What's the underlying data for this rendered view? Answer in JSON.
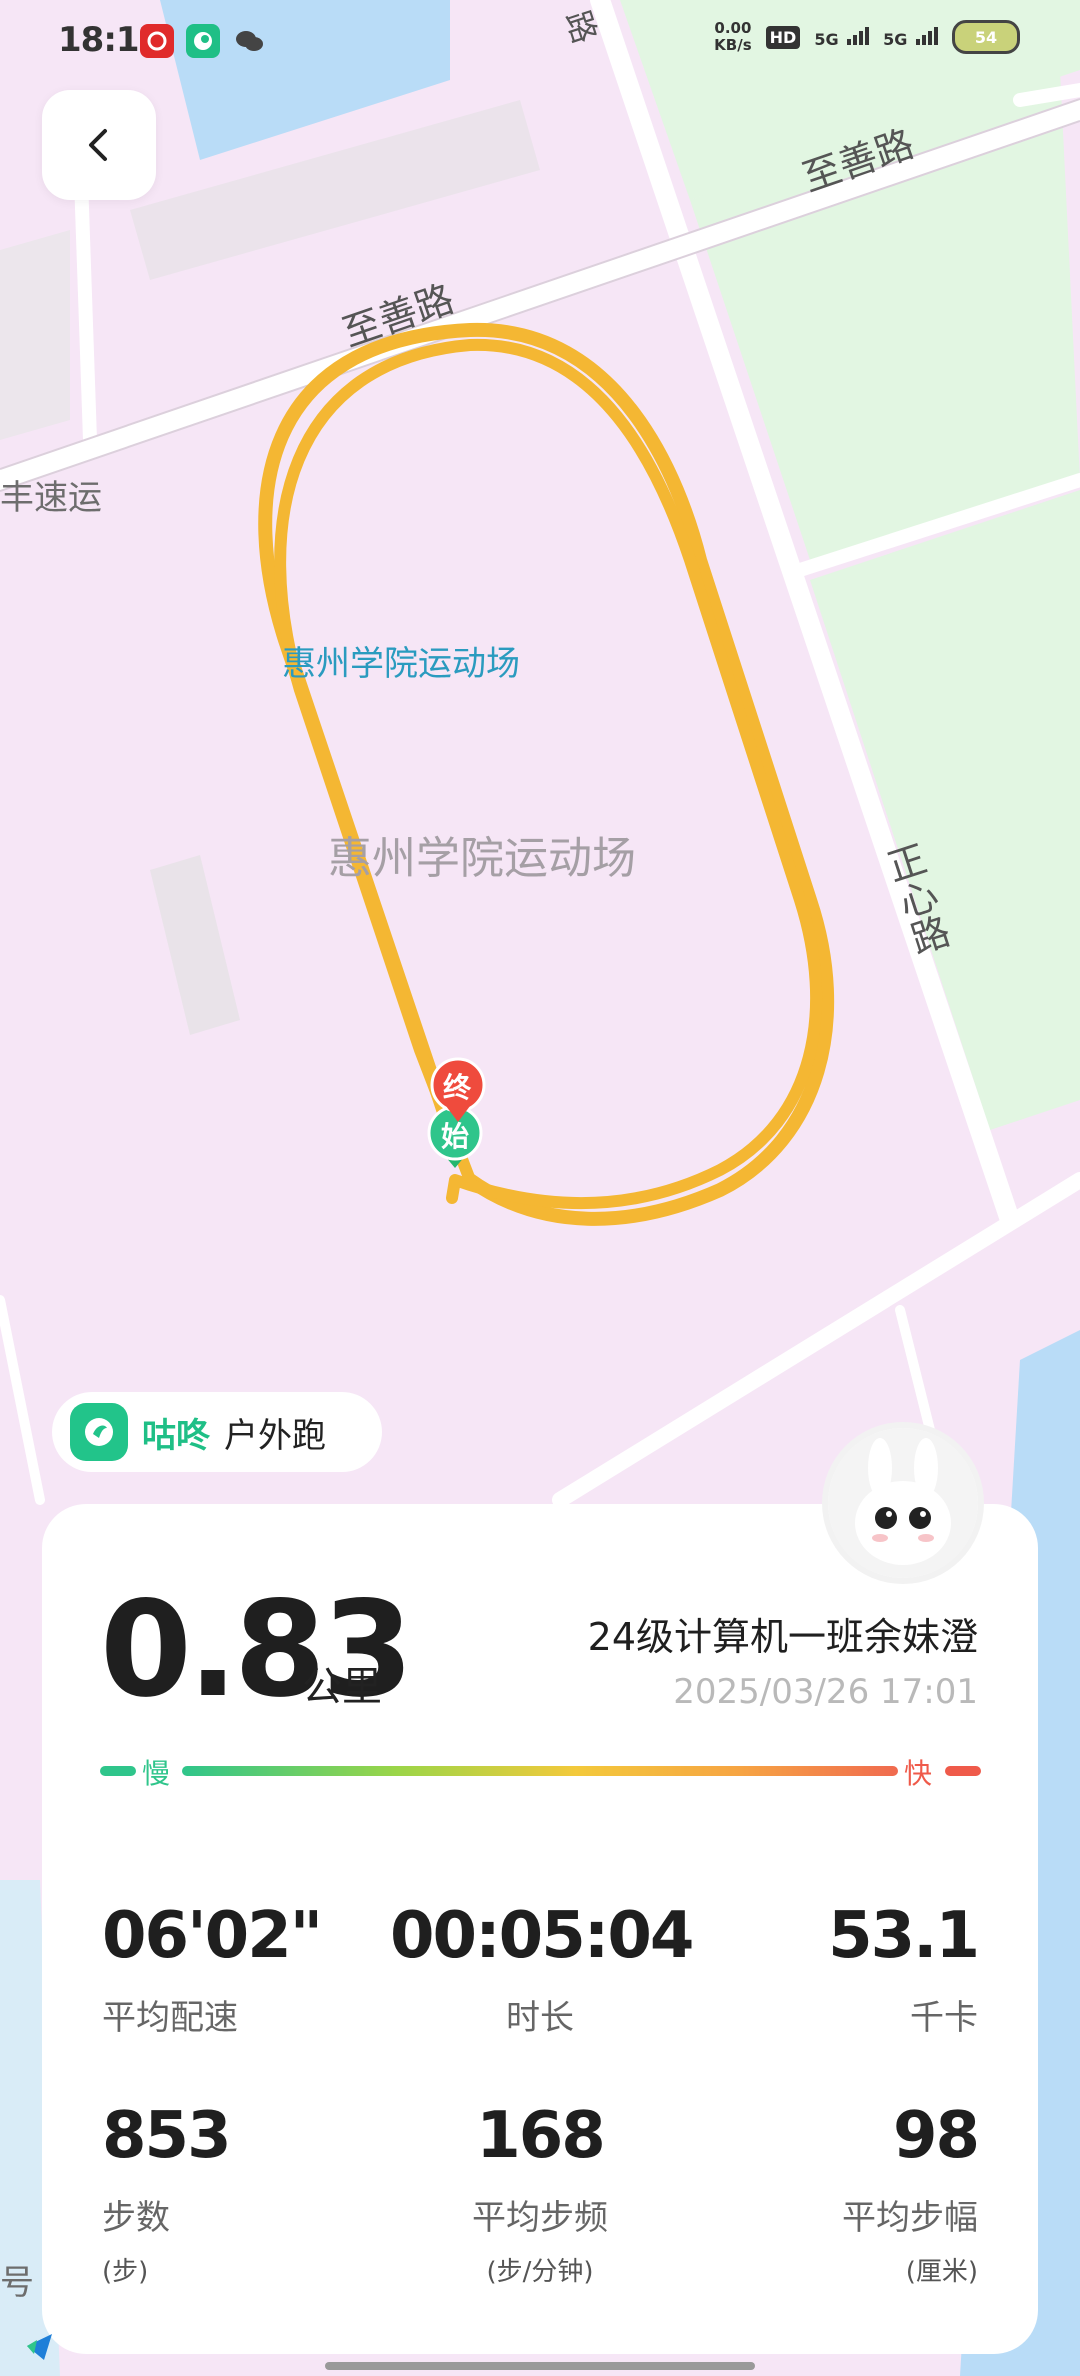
{
  "status_bar": {
    "time": "18:12",
    "net_speed_value": "0.00",
    "net_speed_unit": "KB/s",
    "hd_label": "HD",
    "signal1": "5G",
    "signal2": "5G",
    "battery": "54"
  },
  "map": {
    "roads": [
      "至善路",
      "至善路",
      "正心路",
      "路"
    ],
    "poi_primary": "惠州学院运动场",
    "poi_area": "惠州学院运动场",
    "poi_left": "丰速运",
    "poi_bottom": "号",
    "end_marker": "终",
    "start_marker": "始",
    "route_color": "#f4b733",
    "map_bg": "#f6e6f6",
    "green_area": "#e2f6e2",
    "water": "#b9dcf7"
  },
  "brand": {
    "name": "咕咚",
    "activity_type": "户外跑",
    "color": "#22c48a"
  },
  "summary": {
    "distance": "0.83",
    "distance_unit": "公里",
    "user_name": "24级计算机一班余妹澄",
    "datetime": "2025/03/26 17:01",
    "pace_slow_label": "慢",
    "pace_fast_label": "快"
  },
  "stats": {
    "avg_pace": {
      "value": "06'02\"",
      "label": "平均配速"
    },
    "duration": {
      "value": "00:05:04",
      "label": "时长"
    },
    "calories": {
      "value": "53.1",
      "label": "千卡"
    },
    "steps": {
      "value": "853",
      "label": "步数",
      "unit": "(步)"
    },
    "cadence": {
      "value": "168",
      "label": "平均步频",
      "unit": "(步/分钟)"
    },
    "stride": {
      "value": "98",
      "label": "平均步幅",
      "unit": "(厘米)"
    }
  }
}
